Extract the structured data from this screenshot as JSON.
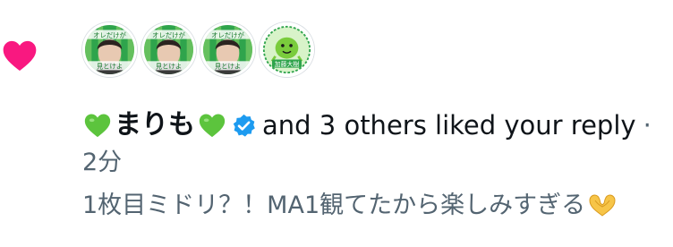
{
  "notification": {
    "user_name": "まりも",
    "action_text": "and 3 others liked your reply",
    "separator": "·",
    "time": "2分",
    "reply_text": "1枚目ミドリ？！MA1観てたから楽しみすぎる",
    "icons": {
      "like": "heart-icon",
      "name_decoration": "green-heart-emoji",
      "verified": "verified-badge-icon",
      "reply_emoji": "heart-hands-emoji"
    },
    "avatar_texts": [
      "オレだけが",
      "加藤大樹",
      "見とけよ"
    ],
    "mascot_badge_text": "加藤大樹"
  },
  "colors": {
    "like_pink": "#f91880",
    "verified_blue": "#1d9bf0",
    "emoji_green": "#5cc43d",
    "secondary_text": "#536471",
    "primary_text": "#0f1419"
  }
}
